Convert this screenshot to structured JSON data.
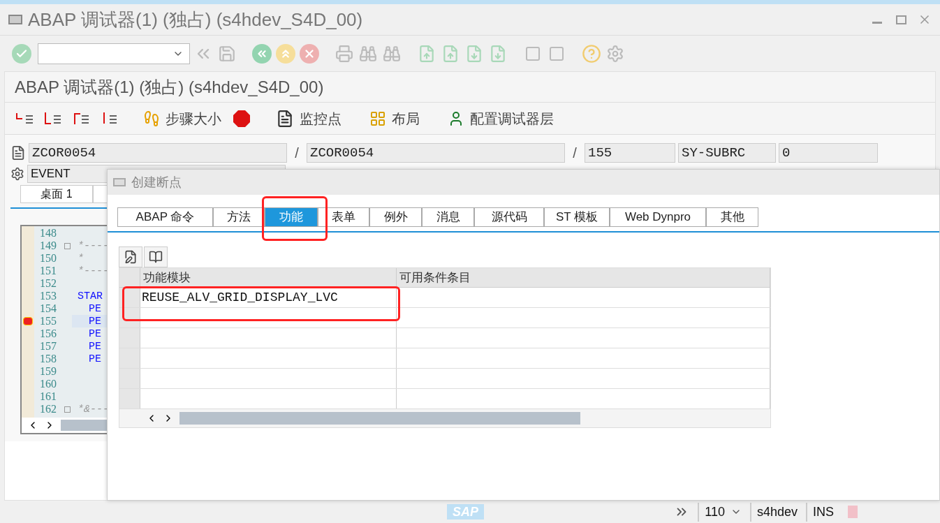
{
  "window": {
    "title": "ABAP 调试器(1)  (独占) (s4hdev_S4D_00)"
  },
  "heading": "ABAP 调试器(1)  (独占) (s4hdev_S4D_00)",
  "debug_toolbar": [
    {
      "kind": "icon"
    },
    {
      "kind": "icon"
    },
    {
      "kind": "icon"
    },
    {
      "kind": "icon"
    },
    {
      "kind": "text",
      "label": "步骤大小"
    },
    {
      "kind": "icon"
    },
    {
      "kind": "text",
      "label": "监控点"
    },
    {
      "kind": "text",
      "label": "布局"
    },
    {
      "kind": "text",
      "label": "配置调试器层"
    }
  ],
  "info_fields": [
    "ZCOR0054",
    "/",
    "ZCOR0054",
    "/",
    "155",
    "SY-SUBRC",
    "0"
  ],
  "event_field": "EVENT",
  "desktop_tabs": [
    {
      "label": "桌面 1",
      "selected": true
    }
  ],
  "code": {
    "lines": [
      {
        "number": "148"
      },
      {
        "number": "149",
        "text": "*----",
        "fold": true
      },
      {
        "number": "150",
        "text": "*"
      },
      {
        "number": "151",
        "text": "*----"
      },
      {
        "number": "152"
      },
      {
        "number": "153",
        "text": "STAR",
        "kind": "keyword"
      },
      {
        "number": "154",
        "text": "PE",
        "kind": "call"
      },
      {
        "number": "155",
        "text": "PE",
        "kind": "call",
        "current": true
      },
      {
        "number": "156",
        "text": "PE",
        "kind": "call"
      },
      {
        "number": "157",
        "text": "PE",
        "kind": "call"
      },
      {
        "number": "158",
        "text": "PE",
        "kind": "call"
      },
      {
        "number": "159"
      },
      {
        "number": "160"
      },
      {
        "number": "161"
      },
      {
        "number": "162",
        "text": "*&---",
        "fold": true
      }
    ]
  },
  "dialog": {
    "title": "创建断点",
    "tabs": [
      {
        "label": "ABAP 命令",
        "selected": false
      },
      {
        "label": "方法",
        "selected": false
      },
      {
        "label": "功能",
        "selected": true
      },
      {
        "label": "表单",
        "selected": false
      },
      {
        "label": "例外",
        "selected": false
      },
      {
        "label": "消息",
        "selected": false
      },
      {
        "label": "源代码",
        "selected": false
      },
      {
        "label": "ST 模板",
        "selected": false
      },
      {
        "label": "Web Dynpro",
        "selected": false
      },
      {
        "label": "其他",
        "selected": false
      }
    ],
    "table": {
      "columns": [
        "功能模块",
        "可用条件条目"
      ],
      "rows": [
        {
          "cells": [
            "REUSE_ALV_GRID_DISPLAY_LVC"
          ]
        }
      ]
    }
  },
  "status_bar": {
    "logo": "SAP",
    "client": "110",
    "system": "s4hdev",
    "mode": "INS"
  }
}
